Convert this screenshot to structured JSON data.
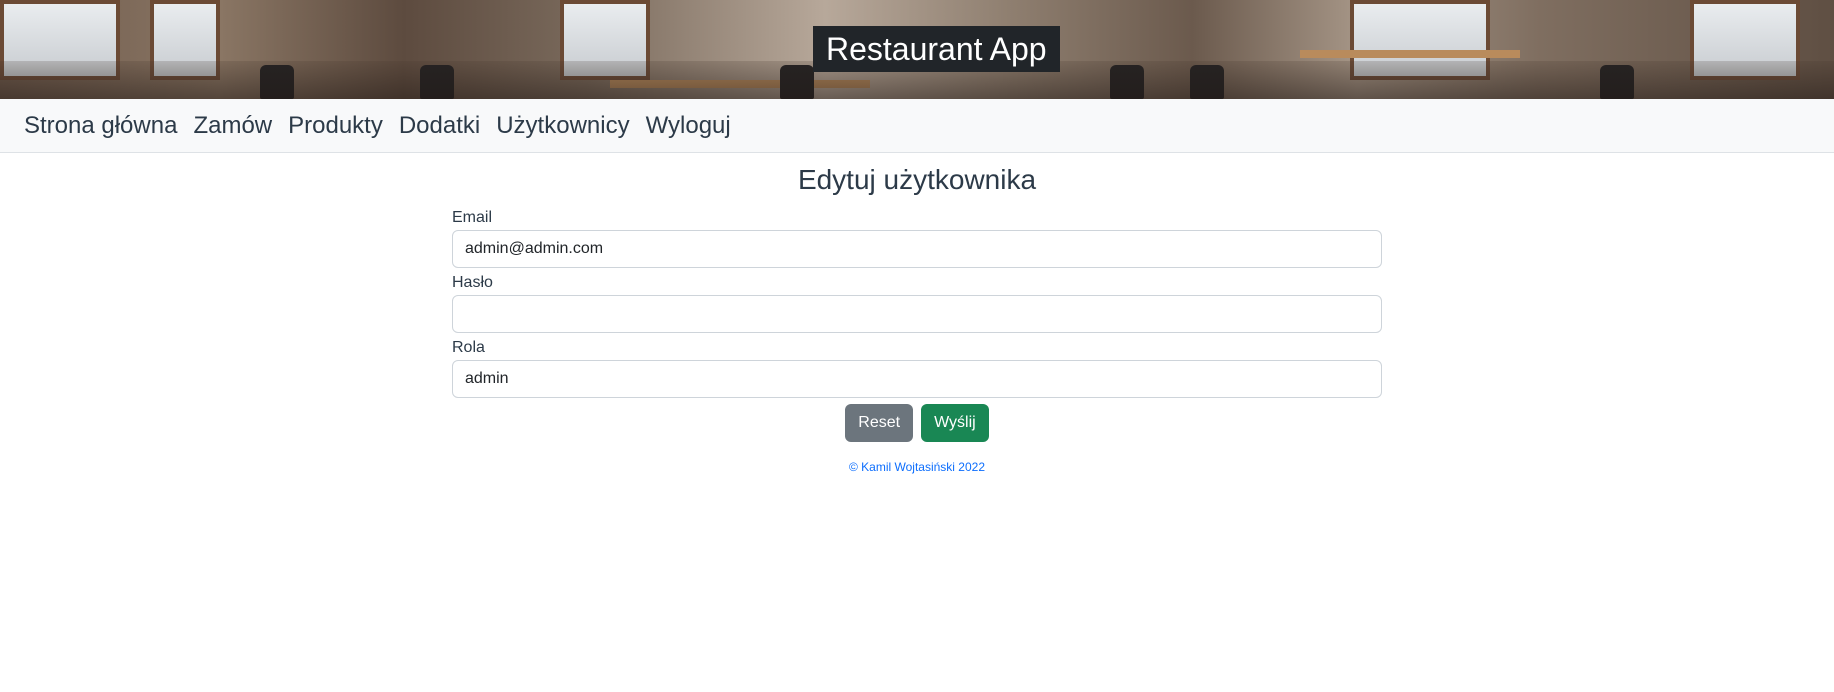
{
  "banner": {
    "title": "Restaurant App"
  },
  "nav": {
    "items": [
      {
        "label": "Strona główna"
      },
      {
        "label": "Zamów"
      },
      {
        "label": "Produkty"
      },
      {
        "label": "Dodatki"
      },
      {
        "label": "Użytkownicy"
      },
      {
        "label": "Wyloguj"
      }
    ]
  },
  "form": {
    "title": "Edytuj użytkownika",
    "email": {
      "label": "Email",
      "value": "admin@admin.com"
    },
    "password": {
      "label": "Hasło",
      "value": ""
    },
    "role": {
      "label": "Rola",
      "value": "admin"
    },
    "reset_label": "Reset",
    "submit_label": "Wyślij"
  },
  "footer": {
    "text": "© Kamil Wojtasiński 2022"
  },
  "colors": {
    "navbar_bg": "#f8f9fa",
    "reset_button": "#6c757d",
    "submit_button": "#198754",
    "footer_link": "#0d6efd",
    "title_badge_bg": "#212529"
  }
}
